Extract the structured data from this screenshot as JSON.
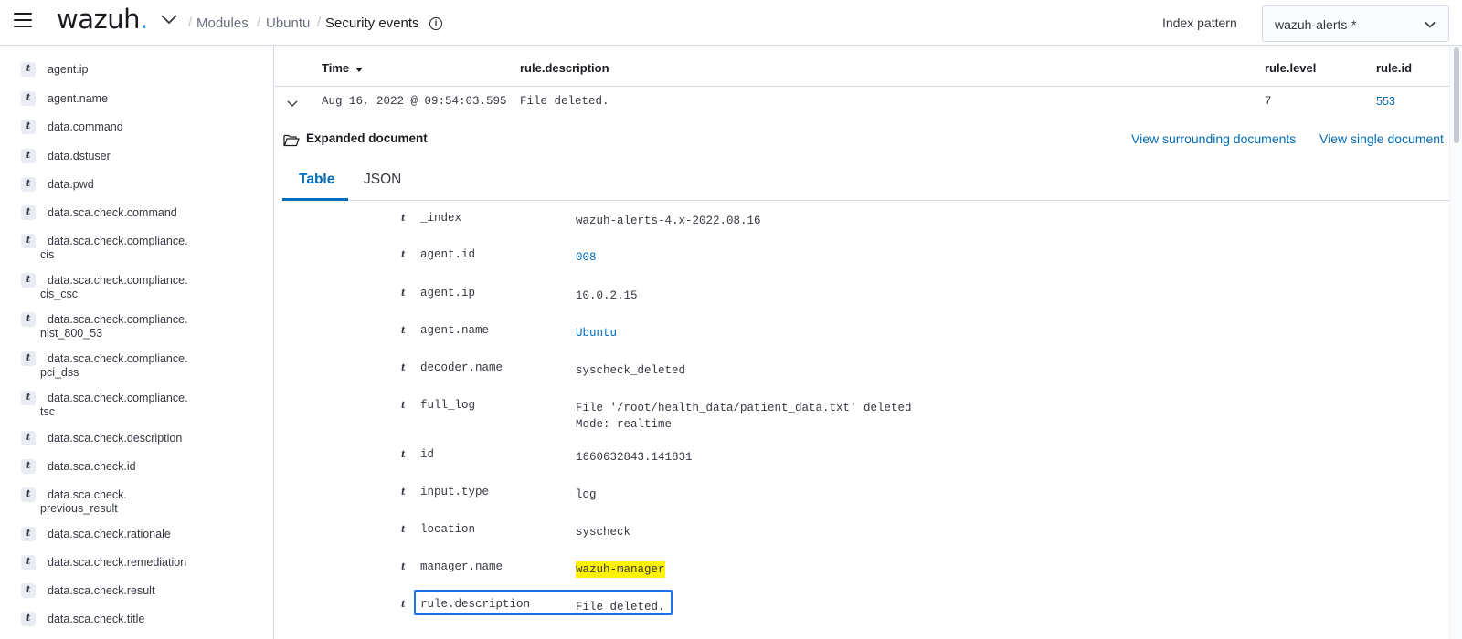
{
  "header": {
    "logo": "wazuh",
    "logo_dot": ".",
    "breadcrumbs": [
      "Modules",
      "Ubuntu",
      "Security events"
    ],
    "separator": "/",
    "info_glyph": "i",
    "index_pattern_label": "Index pattern",
    "index_pattern_value": "wazuh-alerts-*"
  },
  "sidebar": {
    "type_token": "t",
    "fields": [
      {
        "name": "agent.ip"
      },
      {
        "name": "agent.name"
      },
      {
        "name": "data.command"
      },
      {
        "name": "data.dstuser"
      },
      {
        "name": "data.pwd"
      },
      {
        "name": "data.sca.check.command"
      },
      {
        "name": "data.sca.check.compliance.",
        "cont": "cis"
      },
      {
        "name": "data.sca.check.compliance.",
        "cont": "cis_csc"
      },
      {
        "name": "data.sca.check.compliance.",
        "cont": "nist_800_53"
      },
      {
        "name": "data.sca.check.compliance.",
        "cont": "pci_dss"
      },
      {
        "name": "data.sca.check.compliance.",
        "cont": "tsc"
      },
      {
        "name": "data.sca.check.description"
      },
      {
        "name": "data.sca.check.id"
      },
      {
        "name": "data.sca.check.",
        "cont": "previous_result"
      },
      {
        "name": "data.sca.check.rationale"
      },
      {
        "name": "data.sca.check.remediation"
      },
      {
        "name": "data.sca.check.result"
      },
      {
        "name": "data.sca.check.title"
      }
    ]
  },
  "table": {
    "columns": [
      "Time",
      "rule.description",
      "rule.level",
      "rule.id"
    ],
    "row": {
      "time": "Aug 16, 2022 @ 09:54:03.595",
      "description": "File deleted.",
      "level": "7",
      "id": "553"
    }
  },
  "expanded": {
    "title": "Expanded document",
    "view_surrounding": "View surrounding documents",
    "view_single": "View single document",
    "tabs": [
      "Table",
      "JSON"
    ],
    "active_tab": "Table",
    "type_token": "t",
    "fields": [
      {
        "key": "_index",
        "value": "wazuh-alerts-4.x-2022.08.16"
      },
      {
        "key": "agent.id",
        "value": "008",
        "link": true
      },
      {
        "key": "agent.ip",
        "value": "10.0.2.15"
      },
      {
        "key": "agent.name",
        "value": "Ubuntu",
        "link": true
      },
      {
        "key": "decoder.name",
        "value": "syscheck_deleted"
      },
      {
        "key": "full_log",
        "value": "File '/root/health_data/patient_data.txt' deleted\nMode: realtime"
      },
      {
        "key": "id",
        "value": "1660632843.141831"
      },
      {
        "key": "input.type",
        "value": "log"
      },
      {
        "key": "location",
        "value": "syscheck"
      },
      {
        "key": "manager.name",
        "value": "wazuh-manager",
        "highlight": true
      },
      {
        "key": "rule.description",
        "value": "File deleted.",
        "focused": true
      }
    ]
  },
  "colors": {
    "accent": "#006bb8",
    "highlight": "#fff200",
    "focus": "#1a73e8"
  },
  "icons": {
    "menu": "hamburger-icon",
    "logo_caret": "chevron-down-icon",
    "info": "info-icon",
    "select_caret": "chevron-down-icon",
    "sort": "sort-down-icon",
    "row_toggle": "chevron-down-icon",
    "expanded_doc": "folder-open-icon"
  }
}
